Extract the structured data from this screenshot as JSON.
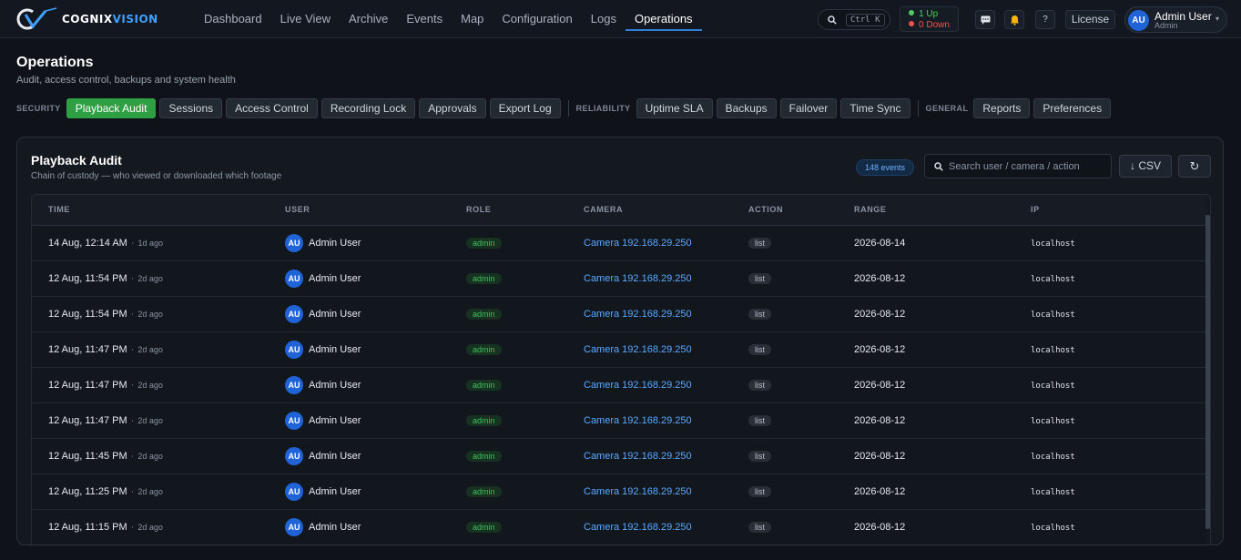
{
  "brand": {
    "name_prefix": "COGNIX",
    "name_suffix": "VISION"
  },
  "nav": {
    "items": [
      {
        "label": "Dashboard",
        "active": false
      },
      {
        "label": "Live View",
        "active": false
      },
      {
        "label": "Archive",
        "active": false
      },
      {
        "label": "Events",
        "active": false
      },
      {
        "label": "Map",
        "active": false
      },
      {
        "label": "Configuration",
        "active": false
      },
      {
        "label": "Logs",
        "active": false
      },
      {
        "label": "Operations",
        "active": true
      }
    ]
  },
  "topbar": {
    "search_shortcut": "Ctrl K",
    "status": {
      "up_count": "1",
      "up_label": "Up",
      "down_count": "0",
      "down_label": "Down"
    },
    "license_label": "License",
    "user": {
      "initials": "AU",
      "name": "Admin User",
      "role": "Admin"
    }
  },
  "colors": {
    "accent": "#2ea043",
    "link": "#5aa8ff",
    "avatar": "#1f63d6",
    "up": "#4ecb5d",
    "down": "#ef5350"
  },
  "page": {
    "title": "Operations",
    "subtitle": "Audit, access control, backups and system health"
  },
  "tab_groups": [
    {
      "label": "SECURITY",
      "tabs": [
        {
          "label": "Playback Audit",
          "active": true
        },
        {
          "label": "Sessions",
          "active": false
        },
        {
          "label": "Access Control",
          "active": false
        },
        {
          "label": "Recording Lock",
          "active": false
        },
        {
          "label": "Approvals",
          "active": false
        },
        {
          "label": "Export Log",
          "active": false
        }
      ]
    },
    {
      "label": "RELIABILITY",
      "tabs": [
        {
          "label": "Uptime SLA",
          "active": false
        },
        {
          "label": "Backups",
          "active": false
        },
        {
          "label": "Failover",
          "active": false
        },
        {
          "label": "Time Sync",
          "active": false
        }
      ]
    },
    {
      "label": "GENERAL",
      "tabs": [
        {
          "label": "Reports",
          "active": false
        },
        {
          "label": "Preferences",
          "active": false
        }
      ]
    }
  ],
  "panel": {
    "title": "Playback Audit",
    "subtitle": "Chain of custody — who viewed or downloaded which footage",
    "count_badge": "148 events",
    "search_placeholder": "Search user / camera / action",
    "csv_label": "↓ CSV",
    "refresh_icon": "↻"
  },
  "table": {
    "columns": [
      "TIME",
      "USER",
      "ROLE",
      "CAMERA",
      "ACTION",
      "RANGE",
      "IP"
    ],
    "rows": [
      {
        "time": "14 Aug, 12:14 AM",
        "ago": "1d ago",
        "initials": "AU",
        "user": "Admin User",
        "role": "admin",
        "camera": "Camera 192.168.29.250",
        "action": "list",
        "range": "2026-08-14",
        "ip": "localhost"
      },
      {
        "time": "12 Aug, 11:54 PM",
        "ago": "2d ago",
        "initials": "AU",
        "user": "Admin User",
        "role": "admin",
        "camera": "Camera 192.168.29.250",
        "action": "list",
        "range": "2026-08-12",
        "ip": "localhost"
      },
      {
        "time": "12 Aug, 11:54 PM",
        "ago": "2d ago",
        "initials": "AU",
        "user": "Admin User",
        "role": "admin",
        "camera": "Camera 192.168.29.250",
        "action": "list",
        "range": "2026-08-12",
        "ip": "localhost"
      },
      {
        "time": "12 Aug, 11:47 PM",
        "ago": "2d ago",
        "initials": "AU",
        "user": "Admin User",
        "role": "admin",
        "camera": "Camera 192.168.29.250",
        "action": "list",
        "range": "2026-08-12",
        "ip": "localhost"
      },
      {
        "time": "12 Aug, 11:47 PM",
        "ago": "2d ago",
        "initials": "AU",
        "user": "Admin User",
        "role": "admin",
        "camera": "Camera 192.168.29.250",
        "action": "list",
        "range": "2026-08-12",
        "ip": "localhost"
      },
      {
        "time": "12 Aug, 11:47 PM",
        "ago": "2d ago",
        "initials": "AU",
        "user": "Admin User",
        "role": "admin",
        "camera": "Camera 192.168.29.250",
        "action": "list",
        "range": "2026-08-12",
        "ip": "localhost"
      },
      {
        "time": "12 Aug, 11:45 PM",
        "ago": "2d ago",
        "initials": "AU",
        "user": "Admin User",
        "role": "admin",
        "camera": "Camera 192.168.29.250",
        "action": "list",
        "range": "2026-08-12",
        "ip": "localhost"
      },
      {
        "time": "12 Aug, 11:25 PM",
        "ago": "2d ago",
        "initials": "AU",
        "user": "Admin User",
        "role": "admin",
        "camera": "Camera 192.168.29.250",
        "action": "list",
        "range": "2026-08-12",
        "ip": "localhost"
      },
      {
        "time": "12 Aug, 11:15 PM",
        "ago": "2d ago",
        "initials": "AU",
        "user": "Admin User",
        "role": "admin",
        "camera": "Camera 192.168.29.250",
        "action": "list",
        "range": "2026-08-12",
        "ip": "localhost"
      }
    ]
  }
}
